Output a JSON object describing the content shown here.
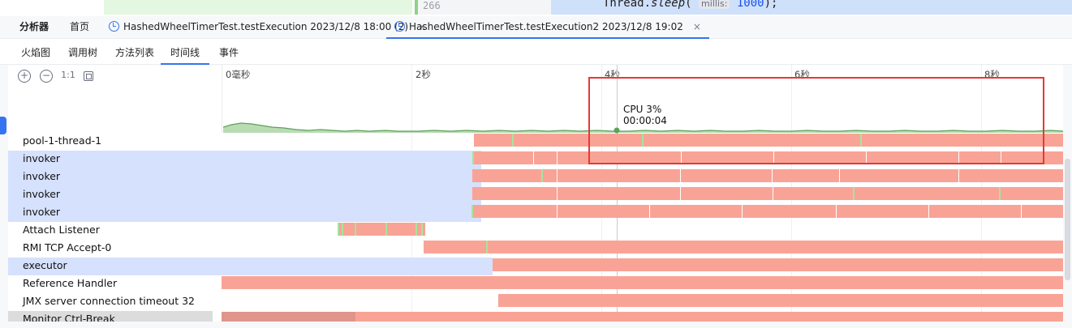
{
  "editor": {
    "line_number": "266",
    "code_prefix": "Thread.",
    "code_method": "sleep",
    "code_open": "(",
    "param_hint": "millis:",
    "code_value": "1000",
    "code_close": ");"
  },
  "tabbar": {
    "title": "分析器",
    "home": "首页",
    "tabs": [
      {
        "label": "HashedWheelTimerTest.testExecution 2023/12/8 18:00 (2)",
        "active": false
      },
      {
        "label": "HashedWheelTimerTest.testExecution2 2023/12/8 19:02",
        "active": true
      }
    ],
    "close_glyph": "×"
  },
  "subtabs": [
    "火焰图",
    "调用树",
    "方法列表",
    "时间线",
    "事件"
  ],
  "active_subtab": "时间线",
  "controls": {
    "zoom_in": "+",
    "zoom_out": "−",
    "one_to_one": "1:1"
  },
  "ruler": {
    "labels": [
      "0毫秒",
      "2秒",
      "4秒",
      "6秒",
      "8秒"
    ]
  },
  "tooltip": {
    "cpu": "CPU 3%",
    "time": "00:00:04"
  },
  "threads": [
    {
      "name": "pool-1-thread-1",
      "selected": false
    },
    {
      "name": "invoker",
      "selected": true
    },
    {
      "name": "invoker",
      "selected": true
    },
    {
      "name": "invoker",
      "selected": true
    },
    {
      "name": "invoker",
      "selected": true
    },
    {
      "name": "Attach Listener",
      "selected": false
    },
    {
      "name": "RMI TCP Accept-0",
      "selected": false
    },
    {
      "name": "executor",
      "selected": true
    },
    {
      "name": "Reference Handler",
      "selected": false
    },
    {
      "name": "JMX server connection timeout 32",
      "selected": false
    },
    {
      "name": "Monitor Ctrl-Break",
      "selected": false
    }
  ],
  "colors": {
    "running": "#f9a396",
    "selected_row": "#d5e1fd",
    "accent": "#3574f0",
    "highlight_box": "#e53935",
    "cpu_area": "#b9dcb3"
  }
}
